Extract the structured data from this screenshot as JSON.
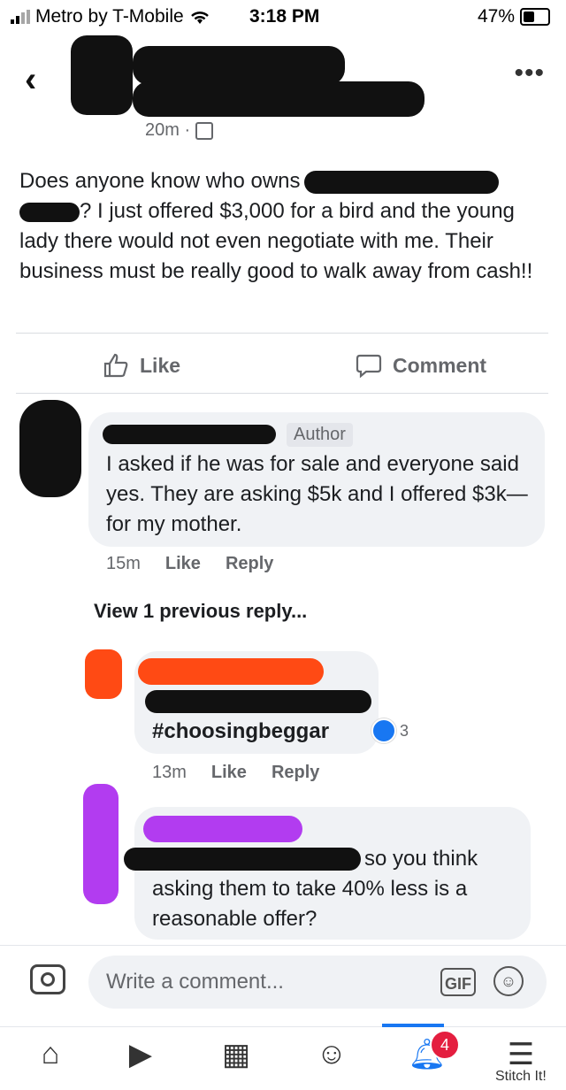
{
  "status_bar": {
    "carrier": "Metro by T-Mobile",
    "time": "3:18 PM",
    "battery": "47%"
  },
  "header": {
    "back_icon": "chevron-left-icon",
    "more_icon": "more-icon",
    "timestamp": "20m ·",
    "privacy_icon": "group-icon"
  },
  "post": {
    "text": [
      "Does anyone know who owns",
      "? I just offered $3,000 for a bird and the young lady there would not even negotiate with me.  Their business must be really good to walk away from cash!!"
    ]
  },
  "actions": {
    "like_label": "Like",
    "comment_label": "Comment"
  },
  "comments": [
    {
      "badge": "Author",
      "text": "I asked if he was for sale and everyone said yes.  They are asking $5k and I offered $3k—for my mother.",
      "time": "15m",
      "like": "Like",
      "reply": "Reply"
    },
    {
      "text": "#choosingbeggar",
      "time": "13m",
      "like": "Like",
      "reply": "Reply",
      "reaction_count": "3"
    },
    {
      "text": "so you think asking them to take 40% less is a reasonable offer?"
    }
  ],
  "view_previous": "View 1 previous reply...",
  "composer": {
    "placeholder": "Write a comment...",
    "gif_label": "GIF"
  },
  "bottom_nav": {
    "notification_count": "4",
    "items": [
      "home-icon",
      "video-icon",
      "marketplace-icon",
      "groups-icon",
      "bell-icon",
      "menu-icon"
    ]
  },
  "watermark": "Stitch It!",
  "colors": {
    "accent": "#1877f2",
    "bubble": "#f0f2f5",
    "secondary_text": "#65676b",
    "badge": "#e41e3f"
  }
}
